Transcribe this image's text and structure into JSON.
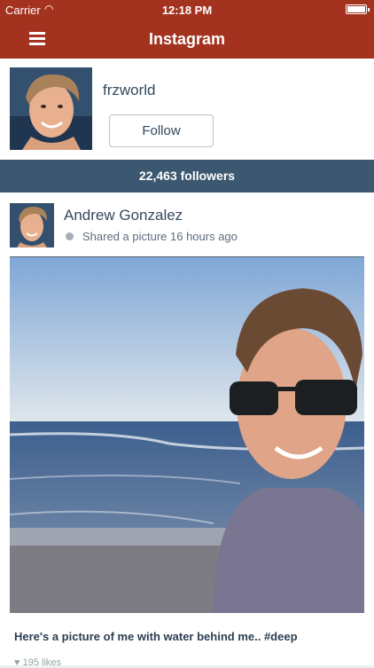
{
  "status_bar": {
    "carrier": "Carrier",
    "time": "12:18 PM"
  },
  "nav": {
    "title": "Instagram",
    "menu_icon": "hamburger-menu-icon"
  },
  "profile": {
    "username": "frzworld",
    "follow_label": "Follow"
  },
  "followers": {
    "text": "22,463 followers"
  },
  "post": {
    "author": "Andrew Gonzalez",
    "meta": "Shared a picture 16 hours ago",
    "caption": "Here's a picture of me with water behind me.. #deep",
    "likes": "♥ 195 likes"
  },
  "colors": {
    "nav": "#a3331f",
    "followers_bar": "#3c5870",
    "text": "#34495e"
  }
}
